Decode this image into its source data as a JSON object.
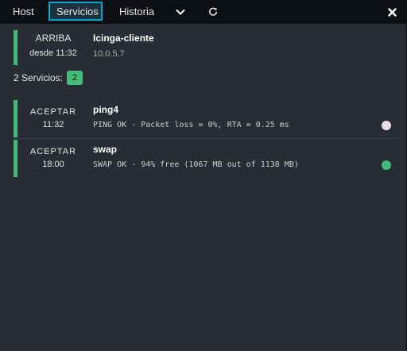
{
  "tabs": {
    "host": "Host",
    "services": "Servicios",
    "history": "Historia"
  },
  "icons": {
    "chevron": "chevron-down-icon",
    "refresh": "refresh-icon",
    "close": "close-icon"
  },
  "host": {
    "state": "ARRIBA",
    "since": "desde 11:32",
    "name": "Icinga-cliente",
    "address": "10.0.5.7",
    "state_color": "#44bb77"
  },
  "services_summary": {
    "label": "2 Servicios:",
    "count": "2"
  },
  "services": [
    {
      "state": "ACEPTAR",
      "time": "11:32",
      "name": "ping4",
      "output": "PING OK - Packet loss = 0%, RTA = 0.25 ms",
      "indicator_color": "#e6dce6",
      "state_color": "#44bb77"
    },
    {
      "state": "ACEPTAR",
      "time": "18:00",
      "name": "swap",
      "output": "SWAP OK - 94% free (1067 MB out of 1138 MB)",
      "indicator_color": "#44bb77",
      "state_color": "#44bb77"
    }
  ],
  "colors": {
    "background": "#282c34",
    "topbar": "#0c1013",
    "active_tab_border": "#00a8d3",
    "ok": "#44bb77"
  }
}
